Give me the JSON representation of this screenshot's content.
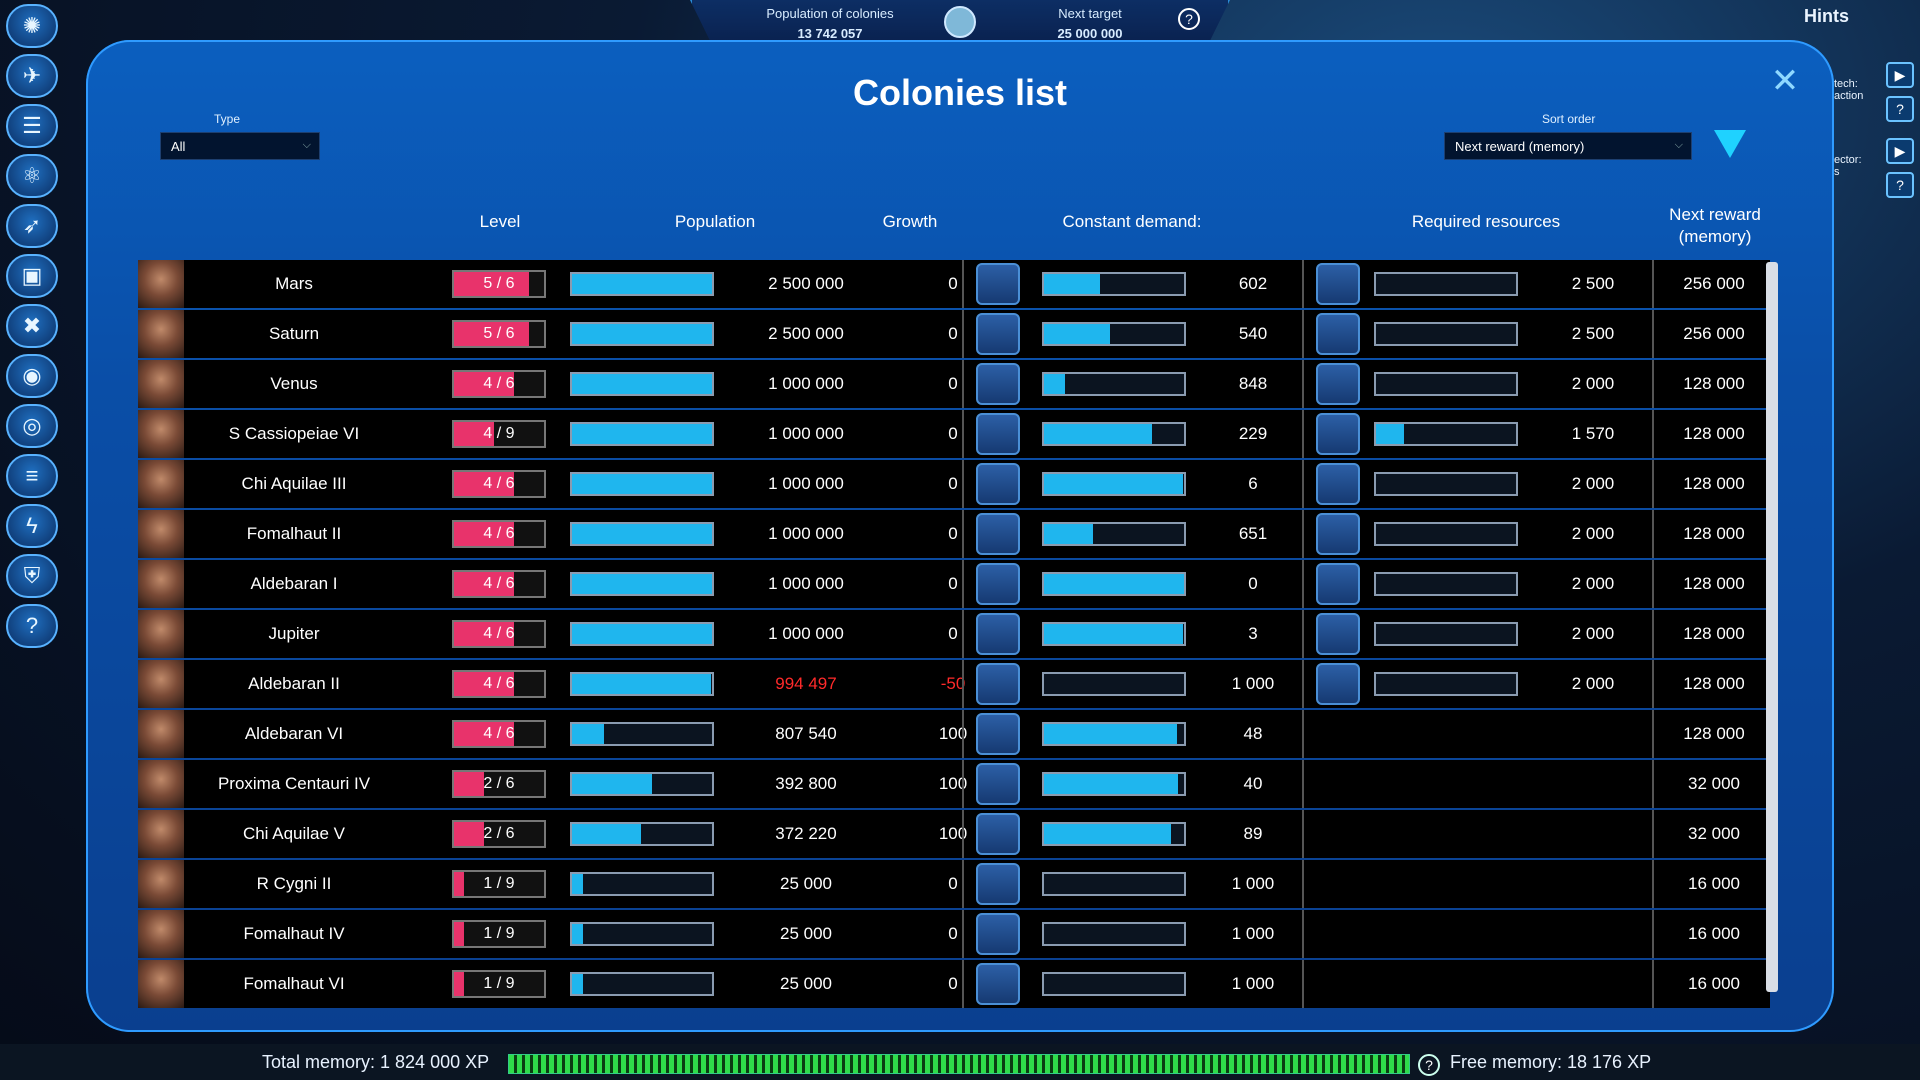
{
  "topbar": {
    "population_label": "Population of colonies",
    "population_value": "13 742 057",
    "next_target_label": "Next target",
    "next_target_value": "25 000 000",
    "help": "?"
  },
  "hints": "Hints",
  "right_panel": [
    {
      "text": "tech:\naction",
      "play": "▶",
      "help": "?"
    },
    {
      "text": "ector:\ns",
      "play": "▶",
      "help": "?"
    }
  ],
  "sidebar_icons": [
    "planet-icon",
    "ship-icon",
    "list-icon",
    "atom-icon",
    "rocket-icon",
    "grid-icon",
    "tools-icon",
    "eye-icon",
    "orbit-icon",
    "stack-icon",
    "energy-icon",
    "shield-icon",
    "help-icon"
  ],
  "modal": {
    "title": "Colonies list",
    "close": "✕",
    "type_label": "Type",
    "type_value": "All",
    "sort_label": "Sort order",
    "sort_value": "Next reward (memory)"
  },
  "headers": {
    "level": "Level",
    "population": "Population",
    "growth": "Growth",
    "demand": "Constant demand:",
    "required": "Required resources",
    "reward_line1": "Next reward",
    "reward_line2": "(memory)"
  },
  "colors": {
    "accent": "#1fb6ee",
    "level": "#e8336b",
    "negative": "#ff2a2a"
  },
  "rows": [
    {
      "name": "Mars",
      "level": "5 / 6",
      "level_frac": 0.83,
      "pop": "2 500 000",
      "pop_frac": 1.0,
      "growth": "0",
      "demand_frac": 0.4,
      "demand": "602",
      "req_frac": 0,
      "req": "2 500",
      "reward": "256 000",
      "neg": false,
      "has_req": true
    },
    {
      "name": "Saturn",
      "level": "5 / 6",
      "level_frac": 0.83,
      "pop": "2 500 000",
      "pop_frac": 1.0,
      "growth": "0",
      "demand_frac": 0.47,
      "demand": "540",
      "req_frac": 0,
      "req": "2 500",
      "reward": "256 000",
      "neg": false,
      "has_req": true
    },
    {
      "name": "Venus",
      "level": "4 / 6",
      "level_frac": 0.67,
      "pop": "1 000 000",
      "pop_frac": 1.0,
      "growth": "0",
      "demand_frac": 0.15,
      "demand": "848",
      "req_frac": 0,
      "req": "2 000",
      "reward": "128 000",
      "neg": false,
      "has_req": true
    },
    {
      "name": "S Cassiopeiae VI",
      "level": "4 / 9",
      "level_frac": 0.44,
      "pop": "1 000 000",
      "pop_frac": 1.0,
      "growth": "0",
      "demand_frac": 0.77,
      "demand": "229",
      "req_frac": 0.2,
      "req": "1 570",
      "reward": "128 000",
      "neg": false,
      "has_req": true
    },
    {
      "name": "Chi Aquilae III",
      "level": "4 / 6",
      "level_frac": 0.67,
      "pop": "1 000 000",
      "pop_frac": 1.0,
      "growth": "0",
      "demand_frac": 0.99,
      "demand": "6",
      "req_frac": 0,
      "req": "2 000",
      "reward": "128 000",
      "neg": false,
      "has_req": true
    },
    {
      "name": "Fomalhaut II",
      "level": "4 / 6",
      "level_frac": 0.67,
      "pop": "1 000 000",
      "pop_frac": 1.0,
      "growth": "0",
      "demand_frac": 0.35,
      "demand": "651",
      "req_frac": 0,
      "req": "2 000",
      "reward": "128 000",
      "neg": false,
      "has_req": true
    },
    {
      "name": "Aldebaran I",
      "level": "4 / 6",
      "level_frac": 0.67,
      "pop": "1 000 000",
      "pop_frac": 1.0,
      "growth": "0",
      "demand_frac": 1.0,
      "demand": "0",
      "req_frac": 0,
      "req": "2 000",
      "reward": "128 000",
      "neg": false,
      "has_req": true
    },
    {
      "name": "Jupiter",
      "level": "4 / 6",
      "level_frac": 0.67,
      "pop": "1 000 000",
      "pop_frac": 1.0,
      "growth": "0",
      "demand_frac": 0.99,
      "demand": "3",
      "req_frac": 0,
      "req": "2 000",
      "reward": "128 000",
      "neg": false,
      "has_req": true
    },
    {
      "name": "Aldebaran II",
      "level": "4 / 6",
      "level_frac": 0.67,
      "pop": "994 497",
      "pop_frac": 0.99,
      "growth": "-50",
      "demand_frac": 0,
      "demand": "1 000",
      "req_frac": 0,
      "req": "2 000",
      "reward": "128 000",
      "neg": true,
      "has_req": true
    },
    {
      "name": "Aldebaran VI",
      "level": "4 / 6",
      "level_frac": 0.67,
      "pop": "807 540",
      "pop_frac": 0.23,
      "growth": "100",
      "demand_frac": 0.95,
      "demand": "48",
      "req_frac": 0,
      "req": "",
      "reward": "128 000",
      "neg": false,
      "has_req": false
    },
    {
      "name": "Proxima Centauri IV",
      "level": "2 / 6",
      "level_frac": 0.33,
      "pop": "392 800",
      "pop_frac": 0.57,
      "growth": "100",
      "demand_frac": 0.96,
      "demand": "40",
      "req_frac": 0,
      "req": "",
      "reward": "32 000",
      "neg": false,
      "has_req": false
    },
    {
      "name": "Chi Aquilae V",
      "level": "2 / 6",
      "level_frac": 0.33,
      "pop": "372 220",
      "pop_frac": 0.49,
      "growth": "100",
      "demand_frac": 0.91,
      "demand": "89",
      "req_frac": 0,
      "req": "",
      "reward": "32 000",
      "neg": false,
      "has_req": false
    },
    {
      "name": "R Cygni II",
      "level": "1 / 9",
      "level_frac": 0.11,
      "pop": "25 000",
      "pop_frac": 0.08,
      "growth": "0",
      "demand_frac": 0,
      "demand": "1 000",
      "req_frac": 0,
      "req": "",
      "reward": "16 000",
      "neg": false,
      "has_req": false
    },
    {
      "name": "Fomalhaut IV",
      "level": "1 / 9",
      "level_frac": 0.11,
      "pop": "25 000",
      "pop_frac": 0.08,
      "growth": "0",
      "demand_frac": 0,
      "demand": "1 000",
      "req_frac": 0,
      "req": "",
      "reward": "16 000",
      "neg": false,
      "has_req": false
    },
    {
      "name": "Fomalhaut VI",
      "level": "1 / 9",
      "level_frac": 0.11,
      "pop": "25 000",
      "pop_frac": 0.08,
      "growth": "0",
      "demand_frac": 0,
      "demand": "1 000",
      "req_frac": 0,
      "req": "",
      "reward": "16 000",
      "neg": false,
      "has_req": false
    }
  ],
  "bottom": {
    "total_memory": "Total memory: 1 824 000 XP",
    "free_memory": "Free memory: 18 176 XP",
    "help": "?"
  }
}
